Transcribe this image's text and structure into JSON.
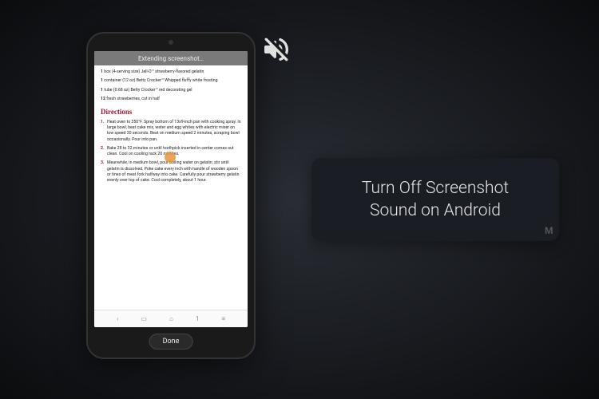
{
  "phone": {
    "status_text": "Extending screenshot…",
    "ingredients": [
      {
        "qty": "1",
        "rest": "box (4-serving size) Jell-O™ strawberry-flavored gelatin"
      },
      {
        "qty": "1",
        "rest": "container (12 oz) Betty Crocker™ Whipped fluffy white frosting"
      },
      {
        "qty": "1",
        "rest": "tube (0.68 oz) Betty Crocker™ red decorating gel"
      },
      {
        "qty": "12",
        "rest": "fresh strawberries, cut in half"
      }
    ],
    "directions_heading": "Directions",
    "steps": [
      "Heat oven to 350°F. Spray bottom of 13x9-inch pan with cooking spray. In large bowl, beat cake mix, water and egg whites with electric mixer on low speed 30 seconds. Beat on medium speed 2 minutes, scraping bowl occasionally. Pour into pan.",
      "Bake 28 to 32 minutes or until toothpick inserted in center comes out clean. Cool on cooling rack 20 minutes.",
      "Meanwhile, in medium bowl, pour boiling water on gelatin; stir until gelatin is dissolved. Poke cake every inch with handle of wooden spoon or tines of meat fork halfway into cake. Carefully pour strawberry gelatin evenly over top of cake. Cool completely, about 1 hour."
    ],
    "nav": {
      "page": "1"
    },
    "done_label": "Done"
  },
  "caption": {
    "line1": "Turn Off Screenshot",
    "line2": "Sound on Android"
  },
  "watermark": "M"
}
